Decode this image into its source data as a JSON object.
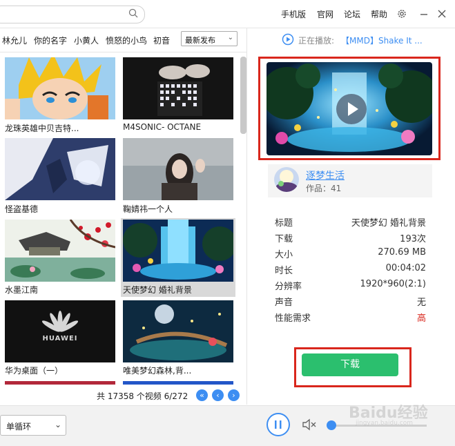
{
  "search": {
    "placeholder": ""
  },
  "header": {
    "links": [
      "手机版",
      "官网",
      "论坛",
      "帮助"
    ]
  },
  "categories": [
    "林允儿",
    "你的名字",
    "小黄人",
    "愤怒的小鸟",
    "初音"
  ],
  "sort": {
    "selected": "最新发布"
  },
  "videos": [
    {
      "title": "龙珠英雄中贝吉特..."
    },
    {
      "title": "M4SONIC- OCTANE"
    },
    {
      "title": "怪盗基德"
    },
    {
      "title": "鞠婧祎一个人"
    },
    {
      "title": "水墨江南"
    },
    {
      "title": "天使梦幻  婚礼背景"
    },
    {
      "title": "华为桌面（一）"
    },
    {
      "title": "唯美梦幻森林,背..."
    }
  ],
  "huawei_logo_text": "HUAWEI",
  "pagination": {
    "summary": "共 17358 个视频  6/272"
  },
  "now_playing": {
    "label": "正在播放:",
    "title": "【MMD】Shake It ..."
  },
  "author": {
    "name": "逐梦生活",
    "works": "作品：41"
  },
  "details": [
    {
      "key": "标题",
      "value": "天使梦幻  婚礼背景"
    },
    {
      "key": "下载",
      "value": "193次"
    },
    {
      "key": "大小",
      "value": "270.69 MB"
    },
    {
      "key": "时长",
      "value": "00:04:02"
    },
    {
      "key": "分辨率",
      "value": "1920*960(2:1)"
    },
    {
      "key": "声音",
      "value": "无"
    },
    {
      "key": "性能需求",
      "value": "高"
    }
  ],
  "download_label": "下载",
  "playback": {
    "mode": "单循环",
    "volume": 0.05
  },
  "watermark": {
    "brand": "Baidu经验",
    "url": "jingyan.baidu.com"
  },
  "colors": {
    "accent": "#3d8ef2",
    "download": "#2bbf6e",
    "highlight": "#d9261c",
    "high_requirement": "#d9261c"
  }
}
